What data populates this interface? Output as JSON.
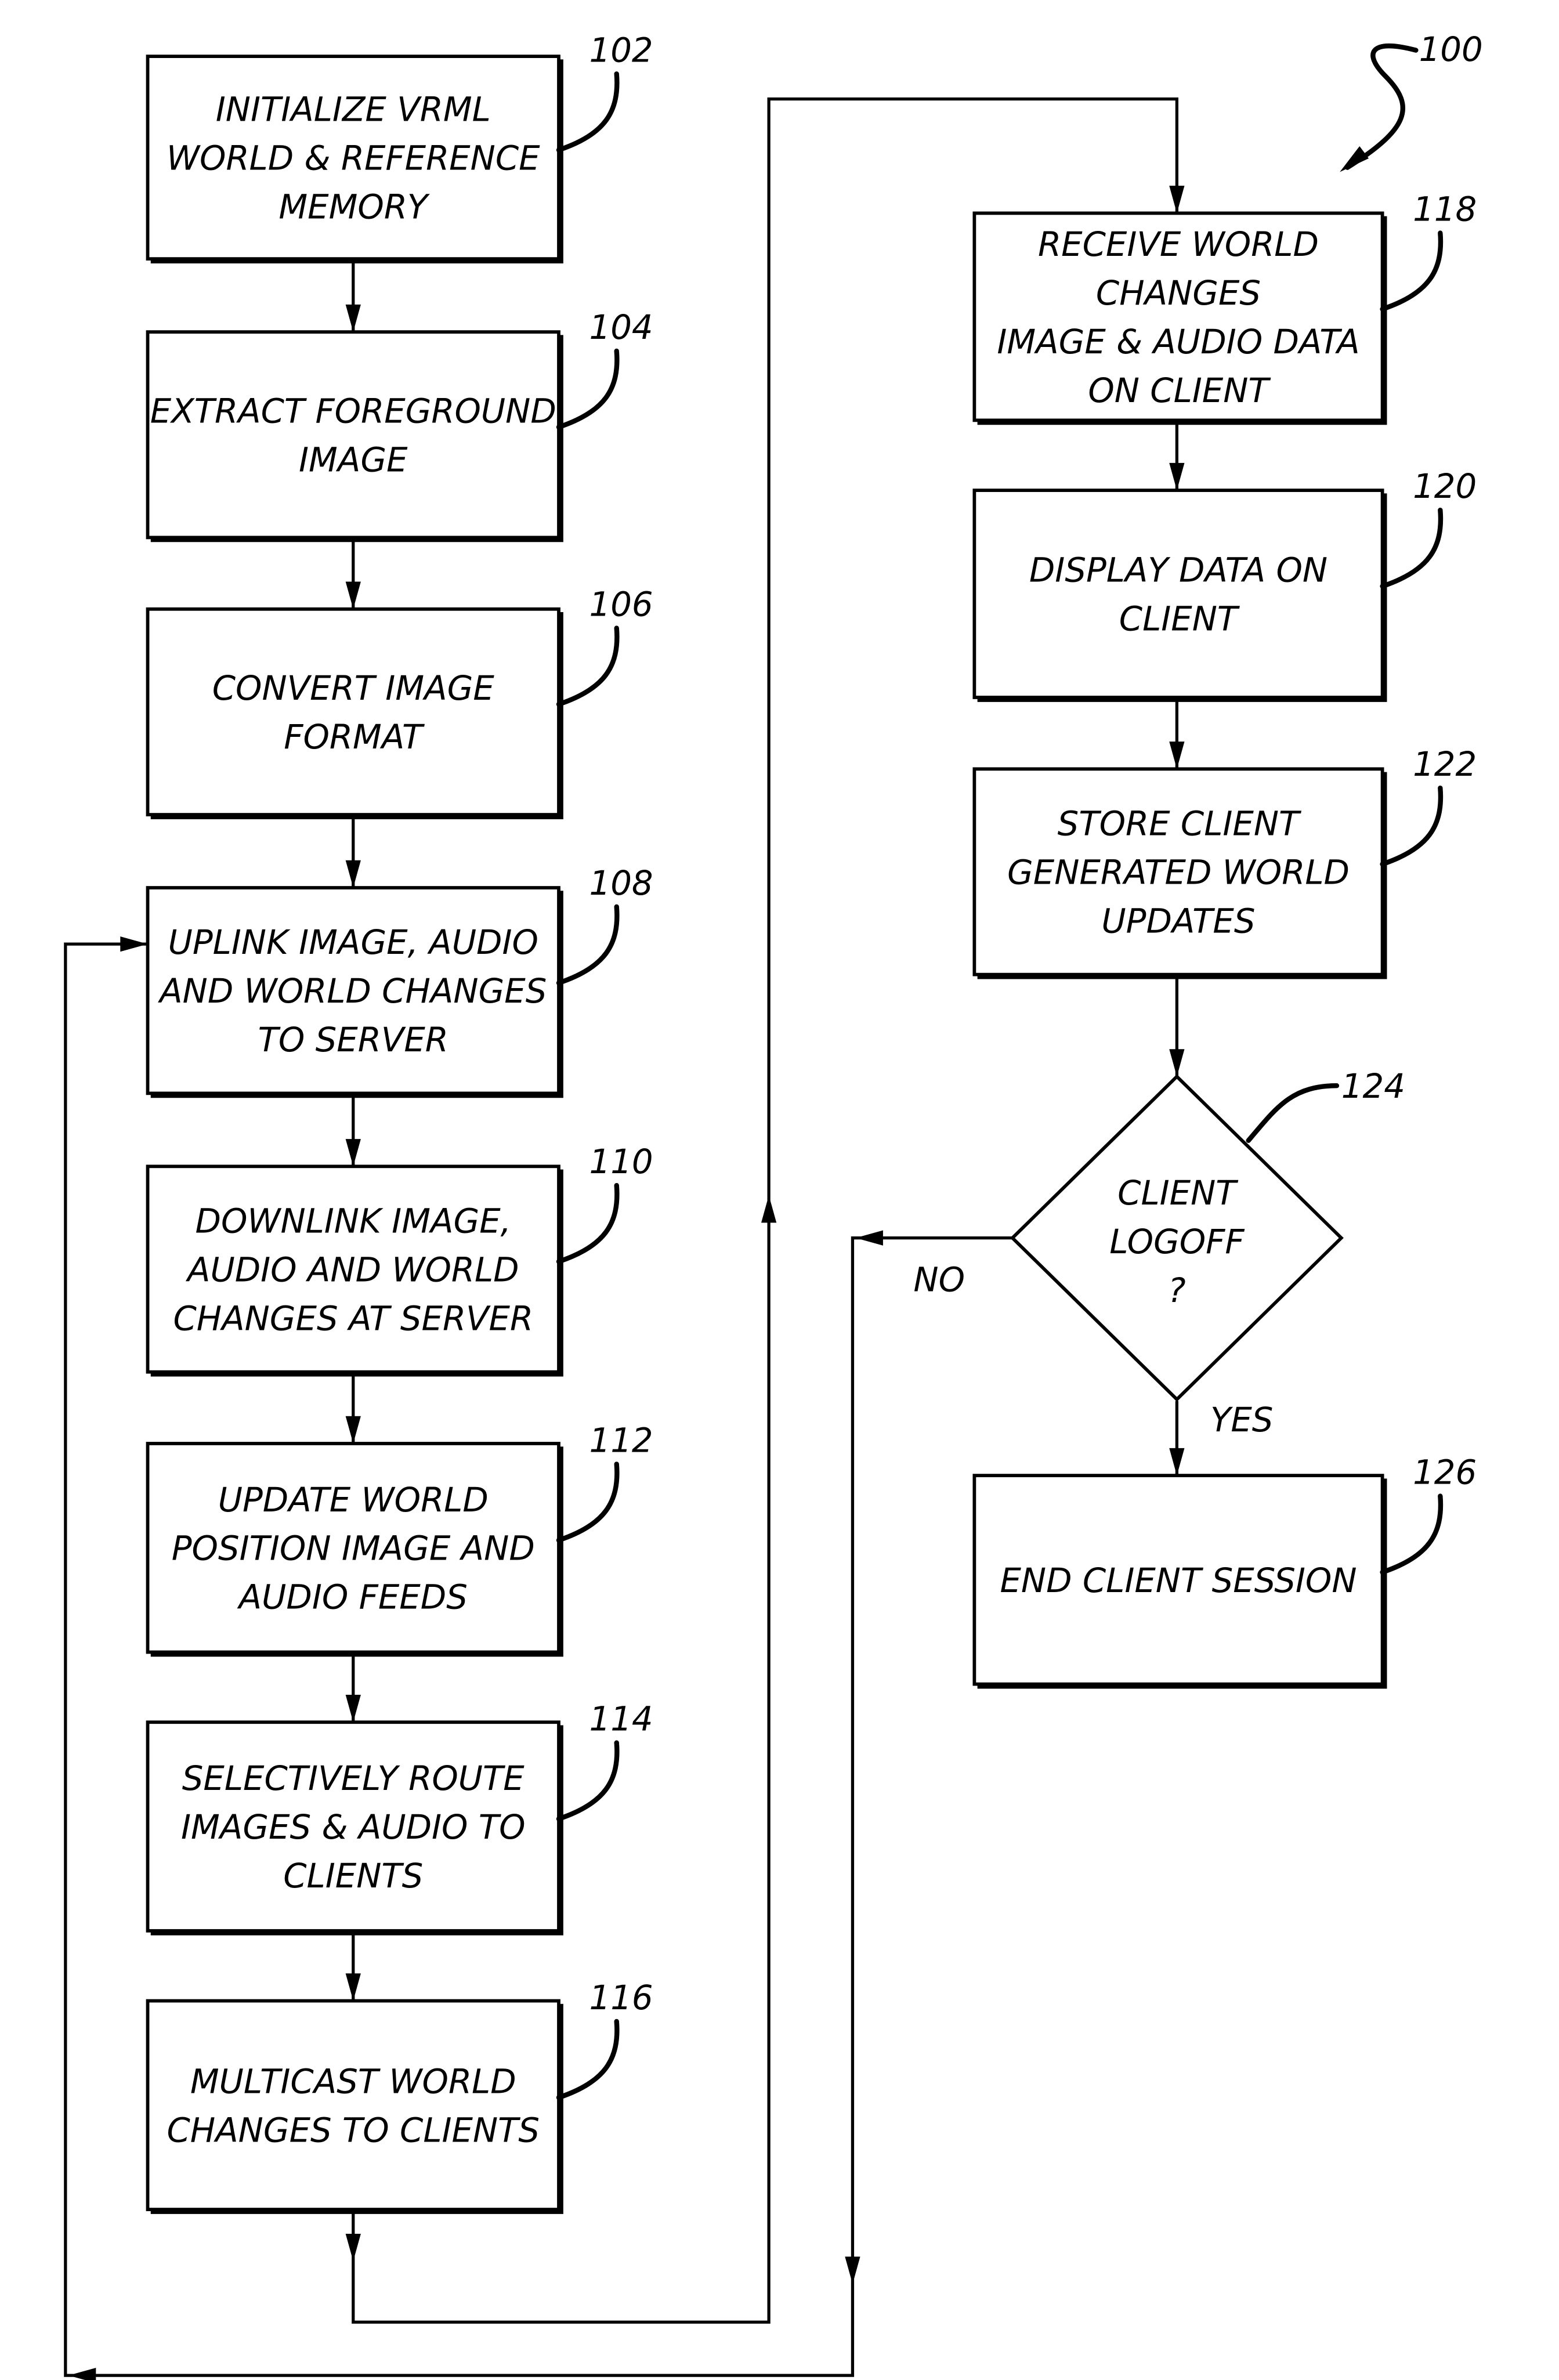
{
  "figure": {
    "ref_number": "100"
  },
  "steps": [
    {
      "id": "102",
      "lines": [
        "INITIALIZE VRML",
        "WORLD & REFERENCE",
        "MEMORY"
      ]
    },
    {
      "id": "104",
      "lines": [
        "EXTRACT FOREGROUND",
        "IMAGE"
      ]
    },
    {
      "id": "106",
      "lines": [
        "CONVERT IMAGE",
        "FORMAT"
      ]
    },
    {
      "id": "108",
      "lines": [
        "UPLINK IMAGE, AUDIO",
        "AND WORLD CHANGES",
        "TO SERVER"
      ]
    },
    {
      "id": "110",
      "lines": [
        "DOWNLINK IMAGE,",
        "AUDIO AND WORLD",
        "CHANGES AT SERVER"
      ]
    },
    {
      "id": "112",
      "lines": [
        "UPDATE WORLD",
        "POSITION IMAGE AND",
        "AUDIO FEEDS"
      ]
    },
    {
      "id": "114",
      "lines": [
        "SELECTIVELY ROUTE",
        "IMAGES & AUDIO TO",
        "CLIENTS"
      ]
    },
    {
      "id": "116",
      "lines": [
        "MULTICAST WORLD",
        "CHANGES TO CLIENTS"
      ]
    },
    {
      "id": "118",
      "lines": [
        "RECEIVE WORLD",
        "CHANGES",
        "IMAGE & AUDIO DATA",
        "ON CLIENT"
      ]
    },
    {
      "id": "120",
      "lines": [
        "DISPLAY DATA ON",
        "CLIENT"
      ]
    },
    {
      "id": "122",
      "lines": [
        "STORE CLIENT",
        "GENERATED WORLD",
        "UPDATES"
      ]
    },
    {
      "id": "126",
      "lines": [
        "END CLIENT SESSION"
      ]
    }
  ],
  "decision": {
    "id": "124",
    "lines": [
      "CLIENT",
      "LOGOFF",
      "?"
    ],
    "yes_label": "YES",
    "no_label": "NO"
  }
}
